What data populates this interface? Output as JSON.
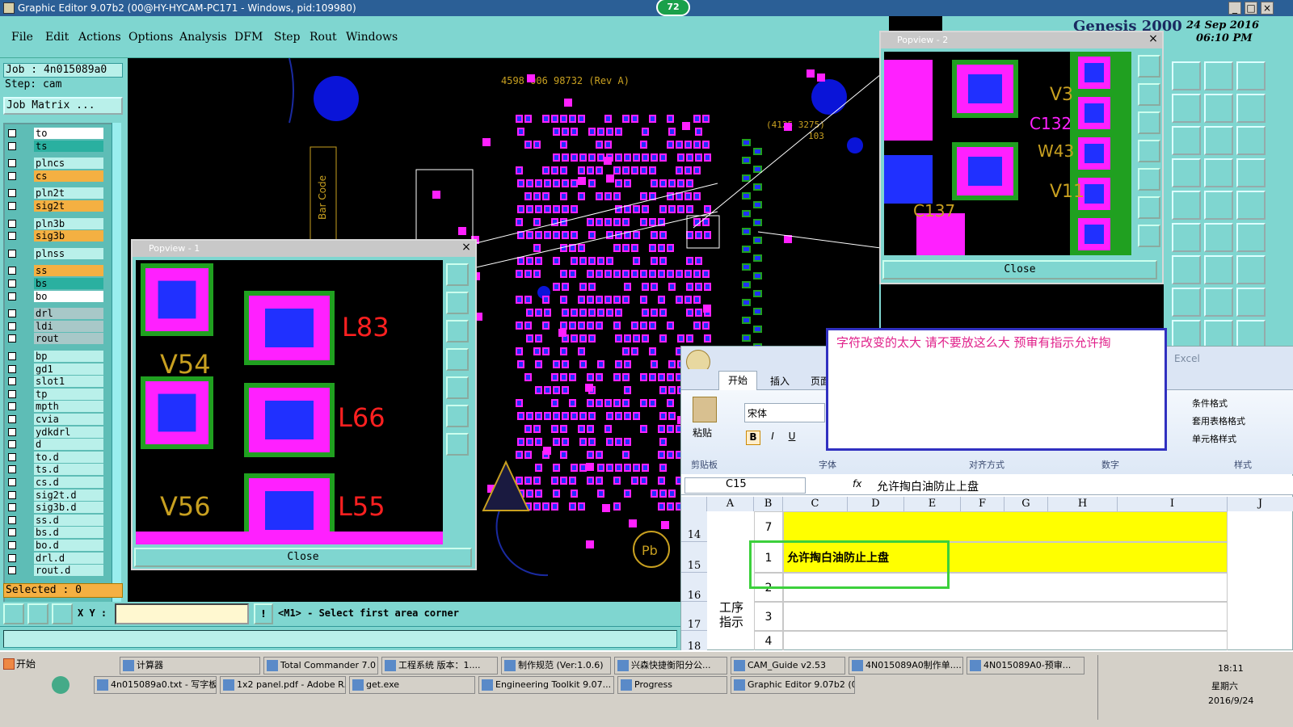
{
  "window": {
    "title": "Graphic Editor 9.07b2 (00@HY-HYCAM-PC171 - Windows, pid:109980)",
    "badge": "72"
  },
  "menu": [
    "File",
    "Edit",
    "Actions",
    "Options",
    "Analysis",
    "DFM",
    "Step",
    "Rout",
    "Windows"
  ],
  "job": {
    "job": "Job : 4n015089a0",
    "step": "Step: cam",
    "matrix": "Job Matrix ..."
  },
  "layers": [
    {
      "name": "to",
      "color": "#ffffff"
    },
    {
      "name": "ts",
      "color": "#2ab0a0"
    },
    {
      "name": "plncs",
      "color": "#b9f0ea"
    },
    {
      "name": "cs",
      "color": "#f4b042"
    },
    {
      "name": "pln2t",
      "color": "#b9f0ea"
    },
    {
      "name": "sig2t",
      "color": "#f4b042"
    },
    {
      "name": "pln3b",
      "color": "#b9f0ea"
    },
    {
      "name": "sig3b",
      "color": "#f4b042"
    },
    {
      "name": "plnss",
      "color": "#b9f0ea"
    },
    {
      "name": "ss",
      "color": "#f4b042"
    },
    {
      "name": "bs",
      "color": "#2ab0a0"
    },
    {
      "name": "bo",
      "color": "#ffffff"
    },
    {
      "name": "drl",
      "color": "#a8c8c8"
    },
    {
      "name": "ldi",
      "color": "#a8c8c8"
    },
    {
      "name": "rout",
      "color": "#a8c8c8"
    },
    {
      "name": "bp",
      "color": "#b9f0ea"
    },
    {
      "name": "gd1",
      "color": "#b9f0ea"
    },
    {
      "name": "slot1",
      "color": "#b9f0ea"
    },
    {
      "name": "tp",
      "color": "#b9f0ea"
    },
    {
      "name": "mpth",
      "color": "#b9f0ea"
    },
    {
      "name": "cvia",
      "color": "#b9f0ea"
    },
    {
      "name": "ydkdrl",
      "color": "#b9f0ea"
    },
    {
      "name": "d",
      "color": "#b9f0ea"
    },
    {
      "name": "to.d",
      "color": "#b9f0ea"
    },
    {
      "name": "ts.d",
      "color": "#b9f0ea"
    },
    {
      "name": "cs.d",
      "color": "#b9f0ea"
    },
    {
      "name": "sig2t.d",
      "color": "#b9f0ea"
    },
    {
      "name": "sig3b.d",
      "color": "#b9f0ea"
    },
    {
      "name": "ss.d",
      "color": "#b9f0ea"
    },
    {
      "name": "bs.d",
      "color": "#b9f0ea"
    },
    {
      "name": "bo.d",
      "color": "#b9f0ea"
    },
    {
      "name": "drl.d",
      "color": "#b9f0ea"
    },
    {
      "name": "rout.d",
      "color": "#b9f0ea"
    }
  ],
  "selected": "Selected : 0",
  "xy_label": "X Y :",
  "prompt": "<M1> - Select first area corner",
  "board_text": {
    "part_no": "4598 006 98732 (Rev A)",
    "code": "(4125 3275)",
    "num": "103",
    "barcode": "Bar Code"
  },
  "popview1": {
    "title": "Popview - 1",
    "close": "Close",
    "labels": [
      "L83",
      "V54",
      "L66",
      "V56",
      "L55"
    ]
  },
  "popview2": {
    "title": "Popview - 2",
    "close": "Close",
    "labels": [
      "V3",
      "C132",
      "W43",
      "V11",
      "C137"
    ]
  },
  "genesis": {
    "brand": "Genesis 2000",
    "date": "24 Sep 2016",
    "time": "06:10 PM"
  },
  "annotation": "字符改变的太大  请不要放这么大    预审有指示允许掏",
  "excel": {
    "app": "Excel",
    "tabs": [
      "开始",
      "插入",
      "页面"
    ],
    "paste": "粘贴",
    "font": "宋体",
    "groups": [
      "剪贴板",
      "字体",
      "对齐方式",
      "数字",
      "样式"
    ],
    "styles": [
      "条件格式",
      "套用表格格式",
      "单元格样式"
    ],
    "cellref": "C15",
    "formula": "允许掏白油防止上盘",
    "cols": [
      "A",
      "B",
      "C",
      "D",
      "E",
      "F",
      "G",
      "H",
      "I",
      "J"
    ],
    "rows": [
      {
        "num": "14",
        "b": "7",
        "c": ""
      },
      {
        "num": "15",
        "b": "1",
        "c": "允许掏白油防止上盘"
      },
      {
        "num": "16",
        "b": "2",
        "c": ""
      },
      {
        "num": "17",
        "b": "3",
        "c": ""
      },
      {
        "num": "18",
        "b": "4",
        "c": ""
      }
    ],
    "merged": "工序\n指示"
  },
  "taskbar": {
    "start": "开始",
    "row1": [
      "计算器",
      "Total Commander 7.0 ...",
      "工程系统  版本：1....",
      "制作规范 (Ver:1.0.6)",
      "兴森快捷衡阳分公...",
      "CAM_Guide v2.53",
      "4N015089A0制作单....",
      "4N015089A0-预审..."
    ],
    "row2": [
      "4n015089a0.txt - 写字板",
      "1x2 panel.pdf - Adobe R...",
      "get.exe",
      "Engineering Toolkit 9.07...",
      "Progress",
      "Graphic Editor 9.07b2 (0..."
    ],
    "clock": "18:11",
    "day": "星期六",
    "date": "2016/9/24"
  }
}
